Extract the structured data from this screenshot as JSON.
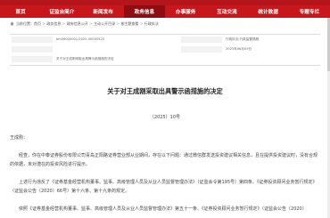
{
  "colors": {
    "nav": "#c8161d",
    "nav_active": "#8e0d12",
    "band": "#b3151b"
  },
  "nav": {
    "items": [
      {
        "label": "首页"
      },
      {
        "label": "证监会简介"
      },
      {
        "label": "新闻发布"
      },
      {
        "label": "政务信息"
      },
      {
        "label": "办事服务"
      },
      {
        "label": "互动交流"
      },
      {
        "label": "统计数据"
      },
      {
        "label": "专题专栏"
      }
    ],
    "active_index": 3
  },
  "breadcrumb": {
    "home_icon": "home-icon",
    "items": [
      "当前位置：",
      "首页",
      "政务信息",
      "政府信息公开",
      "主动公开目录",
      "按主题查看",
      "行政执法"
    ]
  },
  "info": {
    "index_no": "bm56000001/2025-00005520",
    "category": "行政执法;行政监管措施",
    "issuer": "",
    "date": "2025年06月09日",
    "name": "关于对王成刚采取出具警示函措施的决定"
  },
  "document": {
    "title": "关于对王成刚采取出具警示函措施的决定",
    "number": "〔2025〕10号",
    "salutation": "王成刚：",
    "paragraphs": [
      "经查，你在中泰证券股份有限公司青岛正阳路证券营业部从业期间，存在以下问题：通过微信群发送投资建议相关信息，且在提供投资建议时，没有合规的依据，未对潜在的投资风险进行提示。",
      "上述行为违反了《证券基金经营机构董事、监事、高级管理人员及从业人员监督管理办法》（证监会令第195号）第四条、《证券投资顾问业务暂行规定》（证监会公告〔2020〕66号）第十六条、第十九条的规定。",
      "依照《证券基金经营机构董事、监事、高级管理人员及从业人员监督管理办法》第五十一条、《证券投资顾问业务暂行规定》（证监会公告〔2020〕"
    ]
  }
}
